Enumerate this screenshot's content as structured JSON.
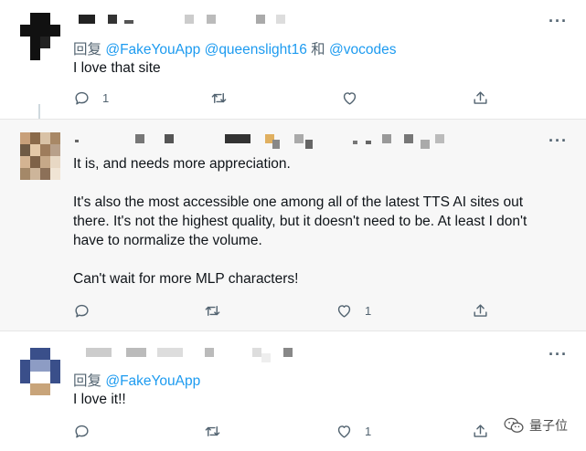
{
  "tweets": [
    {
      "reply_prefix": "回复",
      "mentions": [
        "@FakeYouApp",
        "@queenslight16"
      ],
      "joiner": "和",
      "last_mention": "@vocodes",
      "paragraphs": [
        "I love that site"
      ],
      "reply_count": "1",
      "retweet_count": "",
      "like_count": "",
      "avatar_colors": [
        "#ffffff",
        "#111111",
        "#111111",
        "#ffffff",
        "#111111",
        "#111111",
        "#111111",
        "#111111",
        "#ffffff",
        "#111111",
        "#222222",
        "#ffffff",
        "#ffffff",
        "#111111",
        "#ffffff",
        "#ffffff"
      ]
    },
    {
      "paragraphs": [
        "It is, and needs more appreciation.",
        "It's also the most accessible one among all of the latest TTS AI sites out",
        "there. It's not the highest quality, but it doesn't need to be. At least I don't",
        "have to normalize the volume.",
        "Can't wait for more MLP characters!"
      ],
      "reply_count": "",
      "retweet_count": "",
      "like_count": "1",
      "avatar_colors": [
        "#c8a07a",
        "#8a6a4a",
        "#d9c2a6",
        "#a88866",
        "#6f5a44",
        "#e4c9a8",
        "#9e7c5c",
        "#b8a08a",
        "#d4b492",
        "#7e6248",
        "#c6a888",
        "#e8d8c4",
        "#a48868",
        "#cdb59a",
        "#8c7058",
        "#f0e4d4"
      ]
    },
    {
      "reply_prefix": "回复",
      "mentions": [
        "@FakeYouApp"
      ],
      "paragraphs": [
        "I love it!!"
      ],
      "reply_count": "",
      "retweet_count": "",
      "like_count": "1",
      "avatar_colors": [
        "#ffffff",
        "#3a4f8a",
        "#3a4f8a",
        "#ffffff",
        "#3a4f8a",
        "#8d9cc4",
        "#8d9cc4",
        "#3a4f8a",
        "#3a4f8a",
        "#ffffff",
        "#ffffff",
        "#3a4f8a",
        "#ffffff",
        "#c8a47a",
        "#c8a47a",
        "#ffffff"
      ]
    }
  ],
  "watermark": {
    "text": "量子位",
    "icon": "wechat-icon"
  },
  "colors": {
    "link": "#1d9bf0",
    "muted": "#536471",
    "text": "#0f1419",
    "highlight_bg": "#f7f7f7"
  }
}
